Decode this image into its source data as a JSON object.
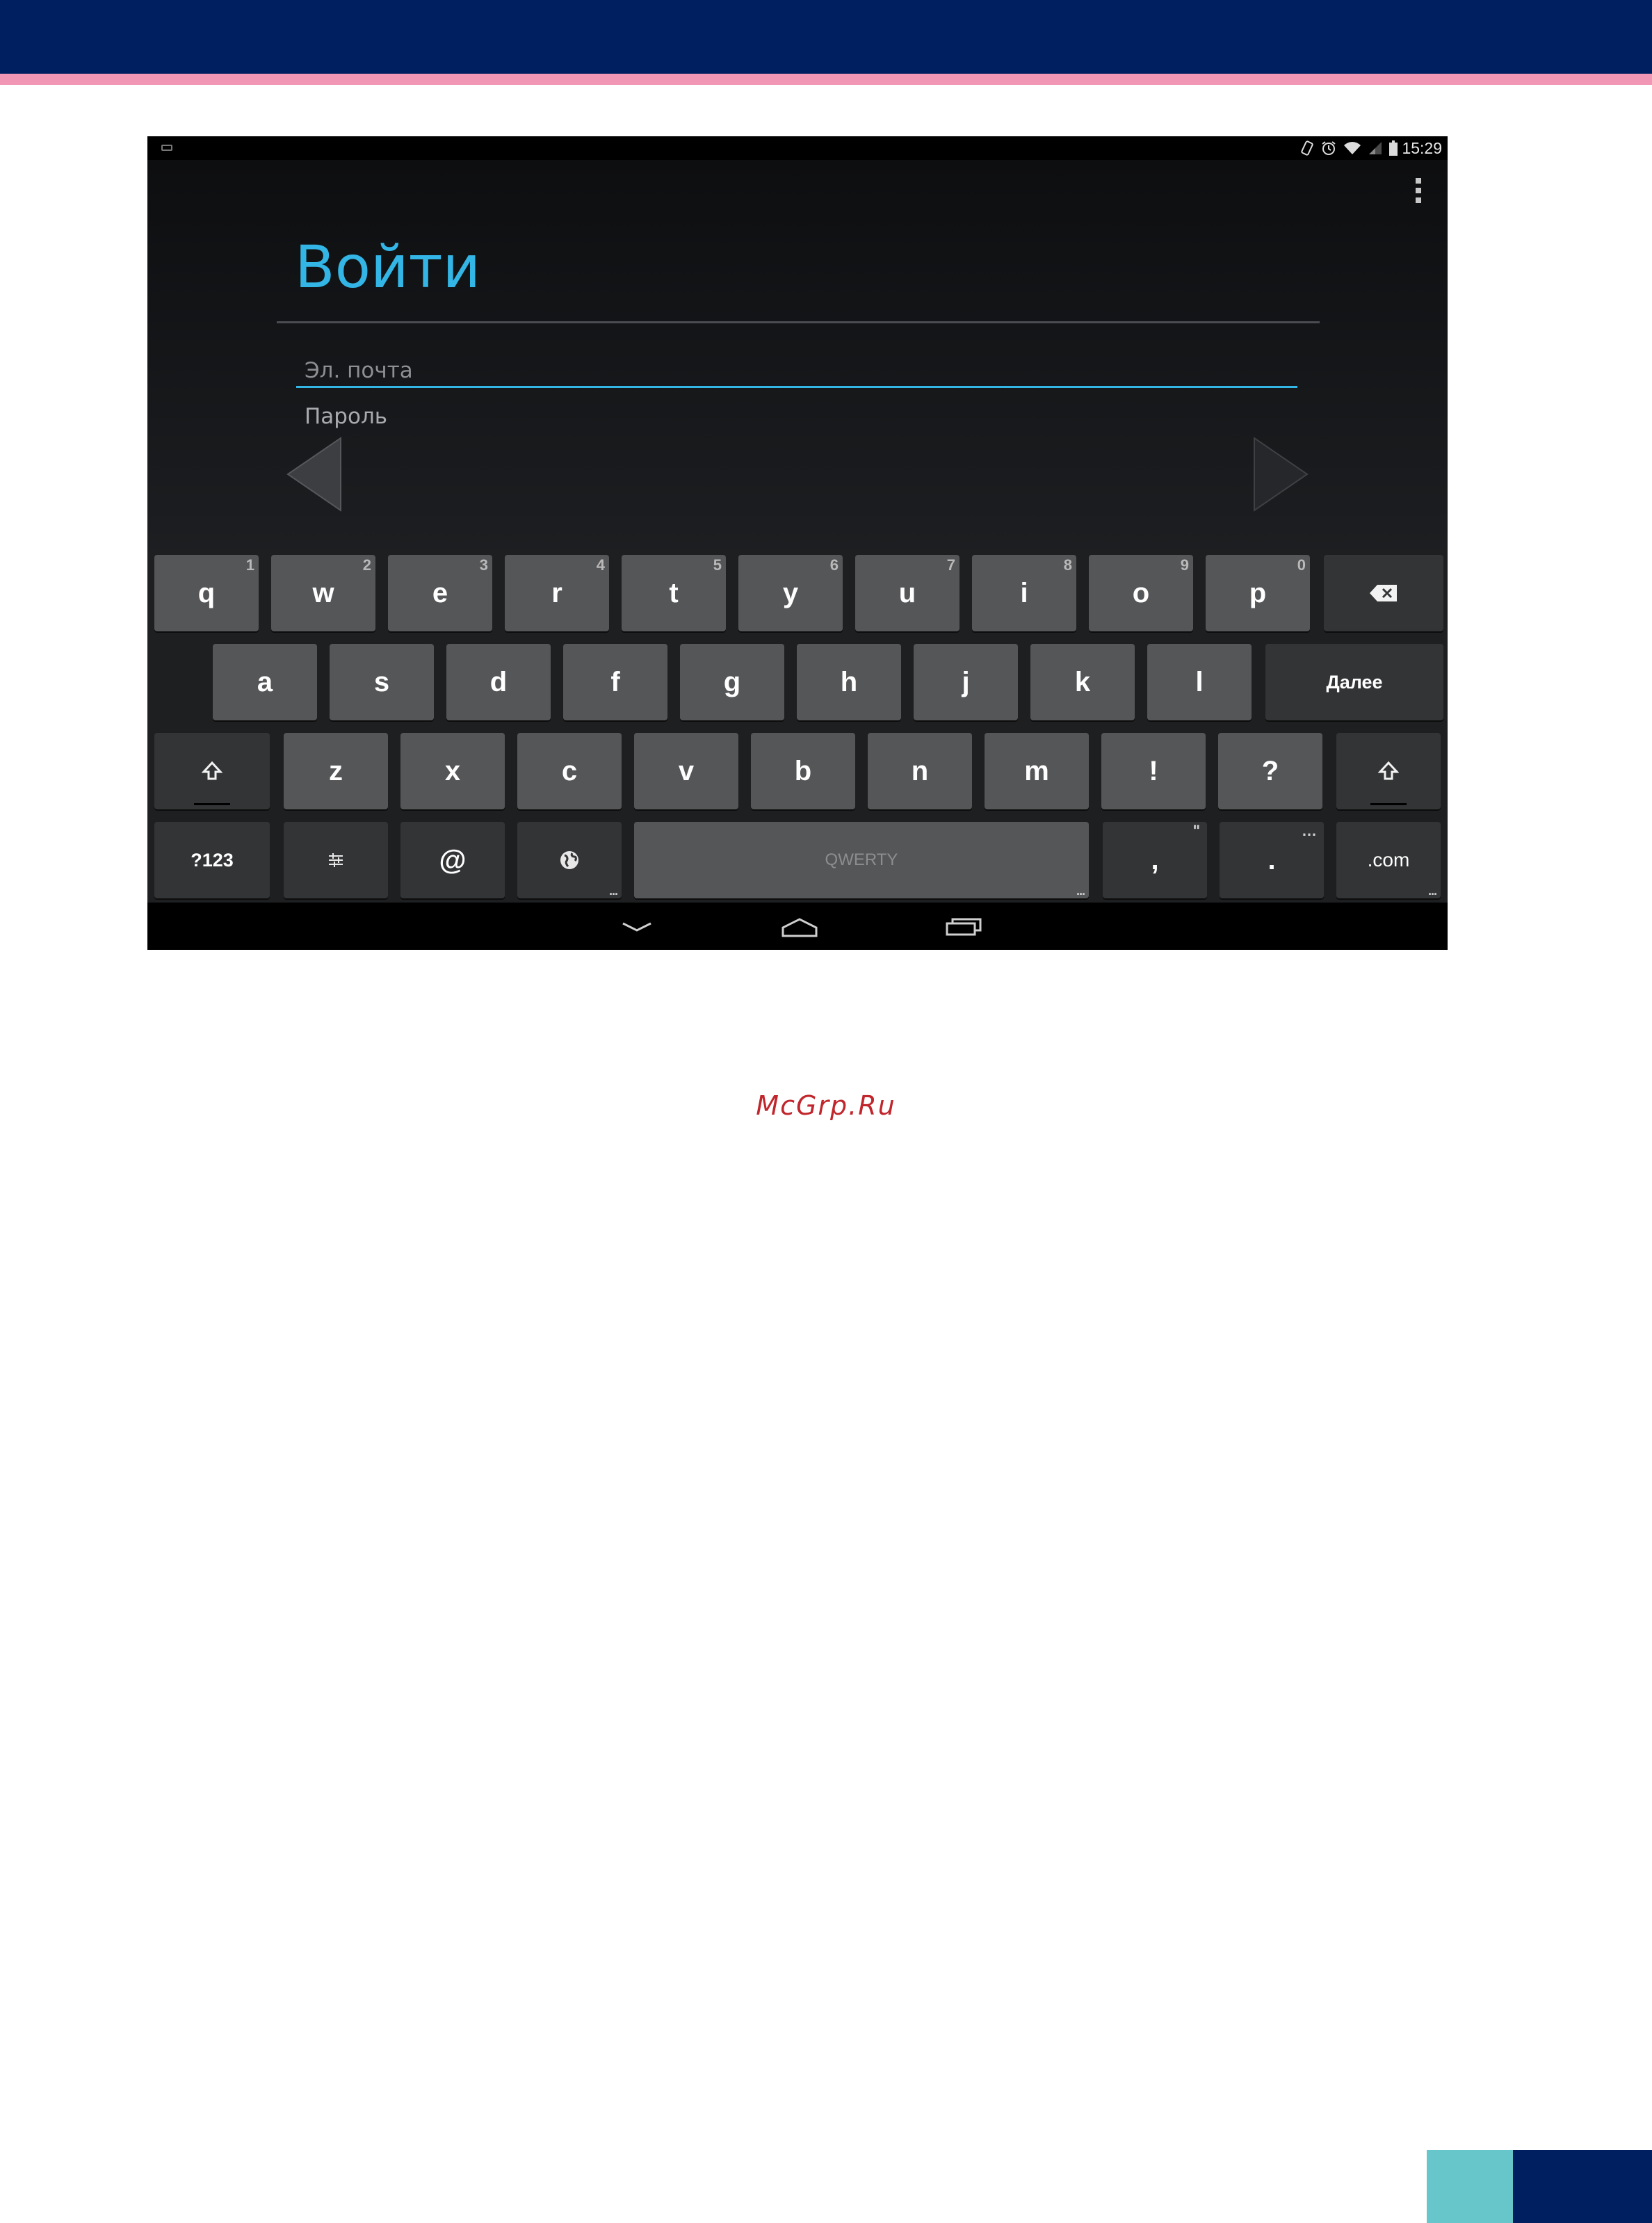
{
  "page": {
    "watermark": "McGrp.Ru"
  },
  "status_bar": {
    "icons": [
      "keyboard-icon",
      "rotation-lock-icon",
      "alarm-icon",
      "wifi-icon",
      "signal-icon",
      "battery-icon"
    ],
    "time": "15:29"
  },
  "app": {
    "title": "Войти",
    "email_placeholder": "Эл. почта",
    "password_placeholder": "Пароль",
    "accent_color": "#33b5e5"
  },
  "keyboard": {
    "row1": [
      {
        "label": "q",
        "sub": "1"
      },
      {
        "label": "w",
        "sub": "2"
      },
      {
        "label": "e",
        "sub": "3"
      },
      {
        "label": "r",
        "sub": "4"
      },
      {
        "label": "t",
        "sub": "5"
      },
      {
        "label": "y",
        "sub": "6"
      },
      {
        "label": "u",
        "sub": "7"
      },
      {
        "label": "i",
        "sub": "8"
      },
      {
        "label": "o",
        "sub": "9"
      },
      {
        "label": "p",
        "sub": "0"
      }
    ],
    "row2": [
      {
        "label": "a"
      },
      {
        "label": "s"
      },
      {
        "label": "d"
      },
      {
        "label": "f"
      },
      {
        "label": "g"
      },
      {
        "label": "h"
      },
      {
        "label": "j"
      },
      {
        "label": "k"
      },
      {
        "label": "l"
      }
    ],
    "next_label": "Далее",
    "row3": [
      {
        "label": "z"
      },
      {
        "label": "x"
      },
      {
        "label": "c"
      },
      {
        "label": "v"
      },
      {
        "label": "b"
      },
      {
        "label": "n"
      },
      {
        "label": "m"
      },
      {
        "label": "!"
      },
      {
        "label": "?"
      }
    ],
    "symbols_label": "?123",
    "at_label": "@",
    "space_label": "QWERTY",
    "comma_label": ",",
    "period_label": ".",
    "dotcom_label": ".com",
    "more_hint": "...",
    "comma_hint": "\"",
    "period_hint": "…"
  },
  "nav_bar": {
    "buttons": [
      "back-icon",
      "home-icon",
      "recent-apps-icon"
    ]
  }
}
